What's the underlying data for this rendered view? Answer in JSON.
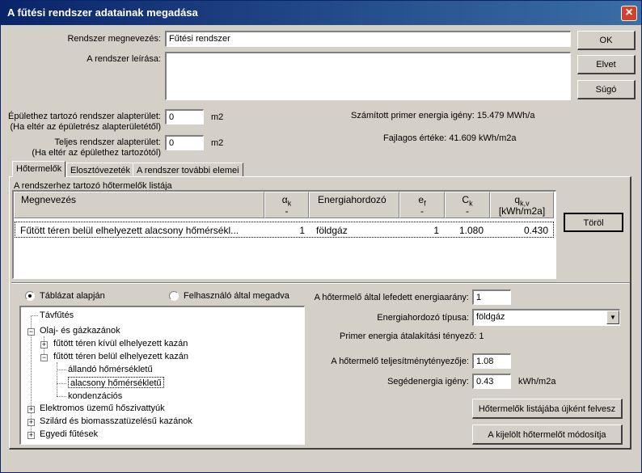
{
  "window": {
    "title": "A fűtési rendszer adatainak megadása",
    "close_glyph": "×"
  },
  "form": {
    "name_label": "Rendszer megnevezés:",
    "name_value": "Fűtési rendszer",
    "desc_label": "A rendszer leírása:",
    "desc_value": "",
    "area1_label": "Épülethez tartozó rendszer alapterület:",
    "area1_note": "(Ha eltér az épületrész alapterületétől)",
    "area1_value": "0",
    "area1_unit": "m2",
    "area2_label": "Teljes rendszer alapterület:",
    "area2_note": "(Ha eltér az épülethez tartozótól)",
    "area2_value": "0",
    "area2_unit": "m2",
    "calc_primary": "Számított primer energia igény: 15.479 MWh/a",
    "calc_specific": "Fajlagos értéke: 41.609 kWh/m2a"
  },
  "buttons": {
    "ok": "OK",
    "cancel": "Elvet",
    "help": "Súgó",
    "delete": "Töröl",
    "add": "Hőtermelők listájába újként felvesz",
    "modify": "A kijelölt hőtermelőt módosítja"
  },
  "tabs": [
    "Hőtermelők",
    "Elosztóvezeték",
    "A rendszer további elemei"
  ],
  "list": {
    "caption": "A rendszerhez tartozó hőtermelők listája",
    "headers": [
      {
        "line1": "Megnevezés",
        "line2": ""
      },
      {
        "line1": "α",
        "sub": "k",
        "line2": "-"
      },
      {
        "line1": "Energiahordozó",
        "line2": ""
      },
      {
        "line1": "e",
        "sub": "f",
        "line2": "-"
      },
      {
        "line1": "C",
        "sub": "k",
        "line2": "-"
      },
      {
        "line1": "q",
        "sub": "k,v",
        "line2": "[kWh/m2a]"
      }
    ],
    "rows": [
      {
        "name": "Fűtött téren belül elhelyezett alacsony hőmérsékl...",
        "alpha": "1",
        "energy": "földgáz",
        "ef": "1",
        "ck": "1.080",
        "qkv": "0.430"
      }
    ]
  },
  "radios": {
    "table": "Táblázat alapján",
    "user": "Felhasználó által megadva"
  },
  "tree": {
    "n1": "Távfűtés",
    "n2": "Olaj- és gázkazánok",
    "n3": "fűtött téren kívül elhelyezett kazán",
    "n4": "fűtött téren belül elhelyezett kazán",
    "n5": "állandó hőmérsékletű",
    "n6": "alacsony hőmérsékletű",
    "n7": "kondenzációs",
    "n8": "Elektromos üzemű hőszivattyúk",
    "n9": "Szilárd és biomasszatüzelésű kazánok",
    "n10": "Egyedi fűtések",
    "plus": "+",
    "minus": "−"
  },
  "right": {
    "coverage_label": "A hőtermelő által lefedett energiaarány:",
    "coverage_value": "1",
    "energy_type_label": "Energiahordozó típusa:",
    "energy_type_value": "földgáz",
    "primer_factor": "Primer energia átalakítási tényező: 1",
    "perf_label": "A hőtermelő teljesítménytényezője:",
    "perf_value": "1.08",
    "aux_label": "Segédenergia igény:",
    "aux_value": "0.43",
    "aux_unit": "kWh/m2a",
    "dropdown_glyph": "▼"
  },
  "colors": {
    "title_start": "#0a246a",
    "title_end": "#3a6ea5",
    "selection": "#0a246a",
    "face": "#d4d0c8"
  }
}
